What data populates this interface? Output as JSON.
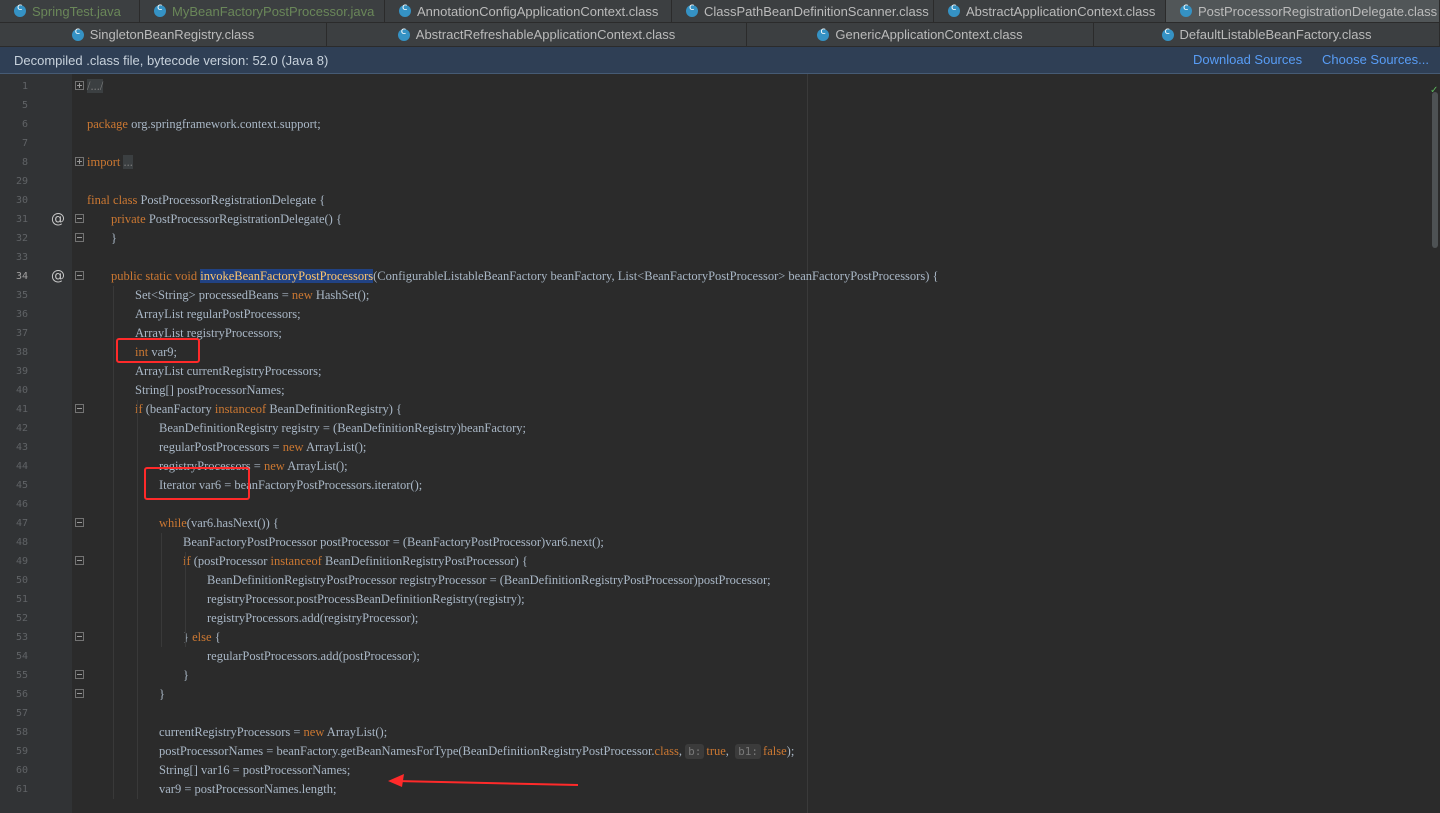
{
  "tabs_row1": [
    {
      "label": "SpringTest.java",
      "icon": "class-icon",
      "active": false,
      "java": true,
      "w": 140
    },
    {
      "label": "MyBeanFactoryPostProcessor.java",
      "icon": "class-icon",
      "active": false,
      "java": true,
      "w": 245
    },
    {
      "label": "AnnotationConfigApplicationContext.class",
      "icon": "class-icon",
      "active": false,
      "java": false,
      "w": 287
    },
    {
      "label": "ClassPathBeanDefinitionScanner.class",
      "icon": "class-icon",
      "active": false,
      "java": false,
      "w": 262
    },
    {
      "label": "AbstractApplicationContext.class",
      "icon": "class-icon",
      "active": false,
      "java": false,
      "w": 232
    },
    {
      "label": "PostProcessorRegistrationDelegate.class",
      "icon": "class-icon",
      "active": true,
      "java": false,
      "w": 274
    }
  ],
  "tabs_row2": [
    {
      "label": "SingletonBeanRegistry.class",
      "icon": "class-icon",
      "active": false,
      "w": 327
    },
    {
      "label": "AbstractRefreshableApplicationContext.class",
      "icon": "class-icon",
      "active": false,
      "w": 420
    },
    {
      "label": "GenericApplicationContext.class",
      "icon": "class-icon",
      "active": false,
      "w": 347
    },
    {
      "label": "DefaultListableBeanFactory.class",
      "icon": "class-icon",
      "active": false,
      "w": 346
    }
  ],
  "banner": {
    "message": "Decompiled .class file, bytecode version: 52.0 (Java 8)",
    "download_sources": "Download Sources",
    "choose_sources": "Choose Sources..."
  },
  "code_lines": [
    {
      "n": "1",
      "fold": "plus",
      "indent": 0,
      "segs": [
        [
          "fold-mark",
          "/.../"
        ]
      ]
    },
    {
      "n": "5",
      "indent": 0,
      "segs": []
    },
    {
      "n": "6",
      "indent": 0,
      "segs": [
        [
          "kw",
          "package"
        ],
        [
          "",
          " org.springframework.context.support;"
        ]
      ]
    },
    {
      "n": "7",
      "indent": 0,
      "segs": []
    },
    {
      "n": "8",
      "fold": "plus",
      "indent": 0,
      "segs": [
        [
          "kw",
          "import"
        ],
        [
          "",
          " "
        ],
        [
          "fold-mark",
          "..."
        ]
      ]
    },
    {
      "n": "29",
      "indent": 0,
      "segs": []
    },
    {
      "n": "30",
      "indent": 0,
      "segs": [
        [
          "kw",
          "final class"
        ],
        [
          "",
          " PostProcessorRegistrationDelegate {"
        ]
      ]
    },
    {
      "n": "31",
      "at": true,
      "fold": "minus",
      "indent": 1,
      "segs": [
        [
          "kw",
          "private"
        ],
        [
          "",
          " PostProcessorRegistrationDelegate() {"
        ]
      ]
    },
    {
      "n": "32",
      "fold": "minus",
      "indent": 1,
      "segs": [
        [
          "",
          "}"
        ]
      ]
    },
    {
      "n": "33",
      "indent": 0,
      "segs": []
    },
    {
      "n": "34",
      "at": true,
      "fold": "minus",
      "cur": true,
      "indent": 1,
      "segs": [
        [
          "kw",
          "public static void"
        ],
        [
          "",
          " "
        ],
        [
          "fn sel",
          "invokeBeanFactoryPostProcessors"
        ],
        [
          "",
          "(ConfigurableListableBeanFactory beanFactory, List<BeanFactoryPostProcessor> beanFactoryPostProcessors) {"
        ]
      ]
    },
    {
      "n": "35",
      "indent": 2,
      "segs": [
        [
          "",
          "Set<String> processedBeans = "
        ],
        [
          "kw",
          "new"
        ],
        [
          "",
          " HashSet();"
        ]
      ]
    },
    {
      "n": "36",
      "indent": 2,
      "segs": [
        [
          "",
          "ArrayList regularPostProcessors;"
        ]
      ]
    },
    {
      "n": "37",
      "indent": 2,
      "segs": [
        [
          "",
          "ArrayList registryProcessors;"
        ]
      ]
    },
    {
      "n": "38",
      "indent": 2,
      "segs": [
        [
          "kw",
          "int"
        ],
        [
          "",
          " var9;"
        ]
      ]
    },
    {
      "n": "39",
      "indent": 2,
      "segs": [
        [
          "",
          "ArrayList currentRegistryProcessors;"
        ]
      ]
    },
    {
      "n": "40",
      "indent": 2,
      "segs": [
        [
          "",
          "String[] postProcessorNames;"
        ]
      ]
    },
    {
      "n": "41",
      "fold": "minus",
      "indent": 2,
      "segs": [
        [
          "kw",
          "if"
        ],
        [
          "",
          " (beanFactory "
        ],
        [
          "kw",
          "instanceof"
        ],
        [
          "",
          " BeanDefinitionRegistry) {"
        ]
      ]
    },
    {
      "n": "42",
      "indent": 3,
      "segs": [
        [
          "",
          "BeanDefinitionRegistry registry = (BeanDefinitionRegistry)beanFactory;"
        ]
      ]
    },
    {
      "n": "43",
      "indent": 3,
      "segs": [
        [
          "",
          "regularPostProcessors = "
        ],
        [
          "kw",
          "new"
        ],
        [
          "",
          " ArrayList();"
        ]
      ]
    },
    {
      "n": "44",
      "indent": 3,
      "segs": [
        [
          "",
          "registryProcessors = "
        ],
        [
          "kw",
          "new"
        ],
        [
          "",
          " ArrayList();"
        ]
      ]
    },
    {
      "n": "45",
      "indent": 3,
      "segs": [
        [
          "",
          "Iterator var6 = beanFactoryPostProcessors.iterator();"
        ]
      ]
    },
    {
      "n": "46",
      "indent": 0,
      "segs": []
    },
    {
      "n": "47",
      "fold": "minus",
      "indent": 3,
      "segs": [
        [
          "kw",
          "while"
        ],
        [
          "",
          "(var6.hasNext()) {"
        ]
      ]
    },
    {
      "n": "48",
      "indent": 4,
      "segs": [
        [
          "",
          "BeanFactoryPostProcessor postProcessor = (BeanFactoryPostProcessor)var6.next();"
        ]
      ]
    },
    {
      "n": "49",
      "fold": "minus",
      "indent": 4,
      "segs": [
        [
          "kw",
          "if"
        ],
        [
          "",
          " (postProcessor "
        ],
        [
          "kw",
          "instanceof"
        ],
        [
          "",
          " BeanDefinitionRegistryPostProcessor) {"
        ]
      ]
    },
    {
      "n": "50",
      "indent": 5,
      "segs": [
        [
          "",
          "BeanDefinitionRegistryPostProcessor registryProcessor = (BeanDefinitionRegistryPostProcessor)postProcessor;"
        ]
      ]
    },
    {
      "n": "51",
      "indent": 5,
      "segs": [
        [
          "",
          "registryProcessor.postProcessBeanDefinitionRegistry(registry);"
        ]
      ]
    },
    {
      "n": "52",
      "indent": 5,
      "segs": [
        [
          "",
          "registryProcessors.add(registryProcessor);"
        ]
      ]
    },
    {
      "n": "53",
      "fold": "minus",
      "indent": 4,
      "segs": [
        [
          "",
          "} "
        ],
        [
          "kw",
          "else"
        ],
        [
          "",
          " {"
        ]
      ]
    },
    {
      "n": "54",
      "indent": 5,
      "segs": [
        [
          "",
          "regularPostProcessors.add(postProcessor);"
        ]
      ]
    },
    {
      "n": "55",
      "fold": "minus",
      "indent": 4,
      "segs": [
        [
          "",
          "}"
        ]
      ]
    },
    {
      "n": "56",
      "fold": "minus",
      "indent": 3,
      "segs": [
        [
          "",
          "}"
        ]
      ]
    },
    {
      "n": "57",
      "indent": 0,
      "segs": []
    },
    {
      "n": "58",
      "indent": 3,
      "segs": [
        [
          "",
          "currentRegistryProcessors = "
        ],
        [
          "kw",
          "new"
        ],
        [
          "",
          " ArrayList();"
        ]
      ]
    },
    {
      "n": "59",
      "indent": 3,
      "segs": [
        [
          "",
          "postProcessorNames = beanFactory.getBeanNamesForType(BeanDefinitionRegistryPostProcessor."
        ],
        [
          "kw",
          "class"
        ],
        [
          "",
          ", "
        ],
        [
          "hint",
          "b:"
        ],
        [
          "kw",
          "true"
        ],
        [
          "",
          ",  "
        ],
        [
          "hint",
          "b1:"
        ],
        [
          "kw",
          "false"
        ],
        [
          "",
          ");"
        ]
      ]
    },
    {
      "n": "60",
      "indent": 3,
      "segs": [
        [
          "",
          "String[] var16 = postProcessorNames;"
        ]
      ]
    },
    {
      "n": "61",
      "indent": 3,
      "segs": [
        [
          "",
          "var9 = postProcessorNames.length;"
        ]
      ]
    }
  ]
}
